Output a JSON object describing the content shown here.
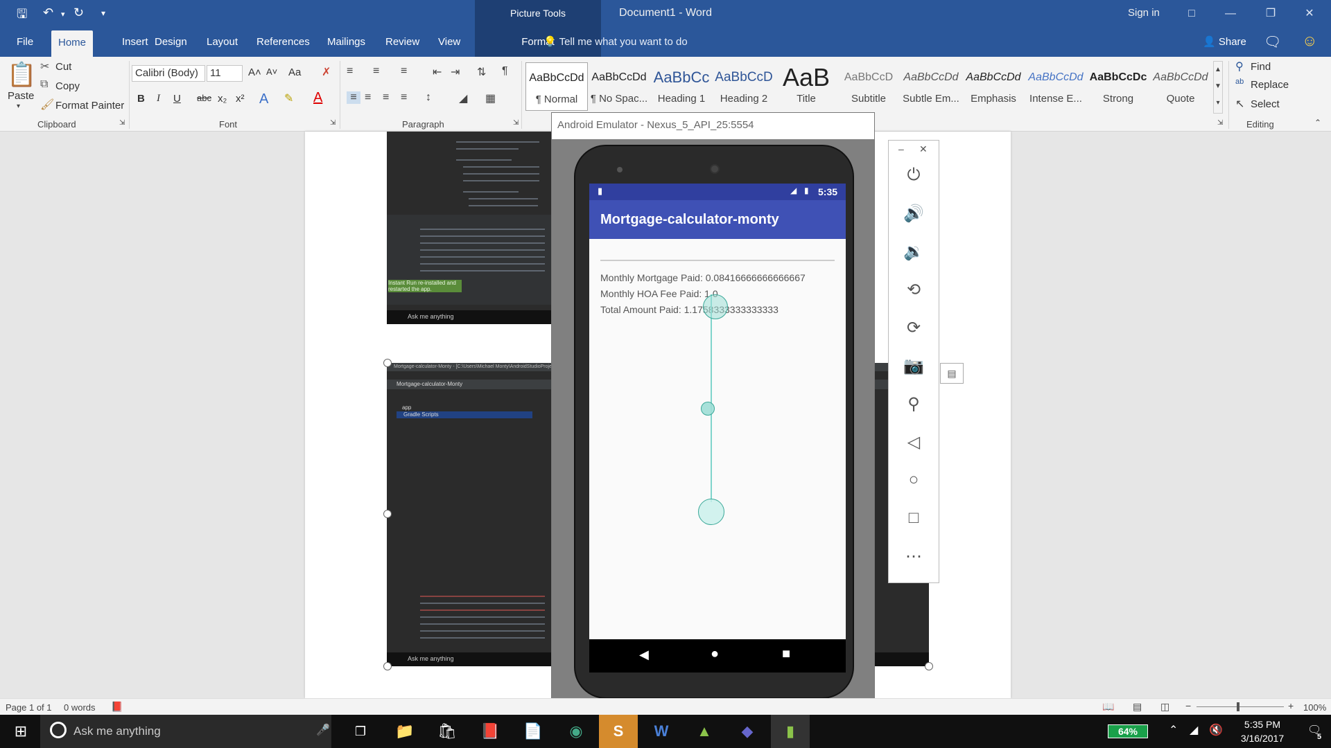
{
  "window": {
    "title": "Document1 - Word",
    "contextual_tab_group": "Picture Tools",
    "sign_in": "Sign in",
    "accent": "#2b579a"
  },
  "tabs": [
    "File",
    "Home",
    "Insert",
    "Design",
    "Layout",
    "References",
    "Mailings",
    "Review",
    "View",
    "Format"
  ],
  "active_tab": "Home",
  "tell_me": "Tell me what you want to do",
  "share": "Share",
  "clipboard": {
    "paste": "Paste",
    "cut": "Cut",
    "copy": "Copy",
    "format_painter": "Format Painter",
    "group": "Clipboard"
  },
  "font": {
    "family": "Calibri (Body)",
    "size": "11",
    "group": "Font",
    "bold": "B",
    "italic": "I",
    "underline": "U",
    "strike": "abc",
    "subscript": "x₂",
    "superscript": "x²",
    "case": "Aa",
    "grow": "A˄",
    "shrink": "A˅"
  },
  "paragraph": {
    "group": "Paragraph"
  },
  "styles": [
    {
      "preview": "AaBbCcDd",
      "name": "¶ Normal"
    },
    {
      "preview": "AaBbCcDd",
      "name": "¶ No Spac..."
    },
    {
      "preview": "AaBbCc",
      "name": "Heading 1"
    },
    {
      "preview": "AaBbCcD",
      "name": "Heading 2"
    },
    {
      "preview": "AaB",
      "name": "Title"
    },
    {
      "preview": "AaBbCcD",
      "name": "Subtitle"
    },
    {
      "preview": "AaBbCcDd",
      "name": "Subtle Em..."
    },
    {
      "preview": "AaBbCcDd",
      "name": "Emphasis"
    },
    {
      "preview": "AaBbCcDd",
      "name": "Intense E..."
    },
    {
      "preview": "AaBbCcDc",
      "name": "Strong"
    },
    {
      "preview": "AaBbCcDd",
      "name": "Quote"
    }
  ],
  "editing": {
    "find": "Find",
    "replace": "Replace",
    "select": "Select",
    "group": "Editing"
  },
  "emulator": {
    "title": "Android Emulator - Nexus_5_API_25:5554",
    "time": "5:35",
    "app_title": "Mortgage-calculator-monty",
    "lines": [
      "Monthly Mortgage Paid: 0.08416666666666667",
      "Monthly HOA Fee Paid: 1.0",
      "Total Amount Paid: 1.1758333333333333"
    ]
  },
  "embedded_screens": {
    "top_hint": "Instant Run re-installed and restarted the app.",
    "bottom_title": "Mortgage-calculator-Monty - [C:\\Users\\Michael Monty\\AndroidStudioProjects\\Mo",
    "bottom_project": "Mortgage-calculator-Monty",
    "tree_app": "app",
    "tree_gradle": "Gradle Scripts",
    "ask": "Ask me anything"
  },
  "status": {
    "page": "Page 1 of 1",
    "words": "0 words",
    "zoom": "100%"
  },
  "taskbar": {
    "search": "Ask me anything",
    "battery": "64%",
    "time": "5:35 PM",
    "date": "3/16/2017",
    "notifications": "5"
  }
}
